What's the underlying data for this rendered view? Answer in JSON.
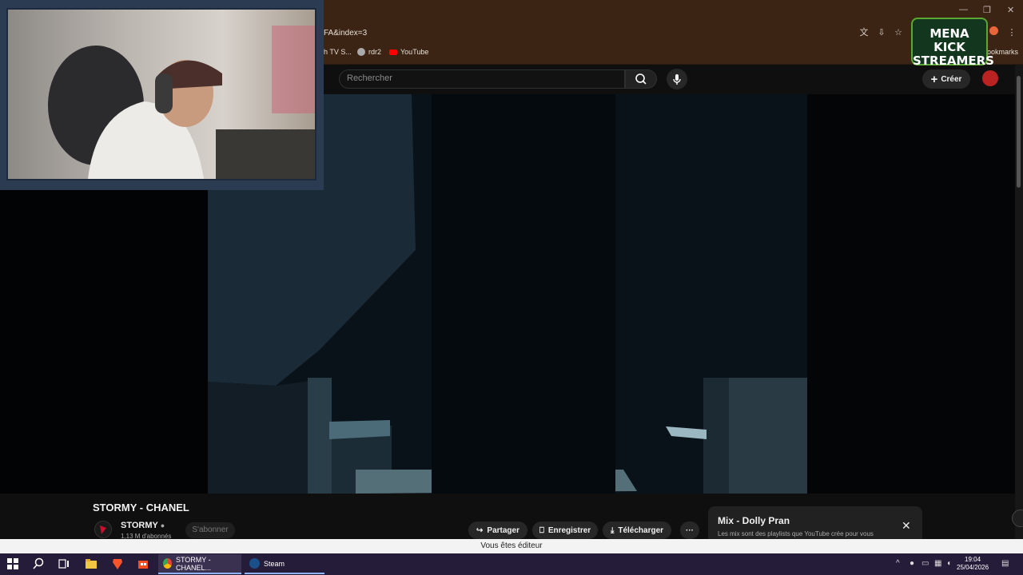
{
  "browser": {
    "url_fragment": "FA&index=3",
    "bookmarks": [
      {
        "label": "h TV S..."
      },
      {
        "label": "rdr2"
      },
      {
        "label": "YouTube"
      }
    ],
    "bookmarks_overflow": "ookmarks"
  },
  "youtube": {
    "search_placeholder": "Rechercher",
    "create_label": "Créer"
  },
  "overlay": {
    "logo_line1": "MENA KICK",
    "logo_line2": "STREAMERS"
  },
  "video": {
    "title": "STORMY - CHANEL",
    "channel": "STORMY",
    "subscribers": "1,13 M d'abonnés",
    "subscribe_label": "S'abonner",
    "actions": {
      "share": "Partager",
      "save": "Enregistrer",
      "download": "Télécharger",
      "more": "···"
    }
  },
  "mix": {
    "title": "Mix - Dolly Pran",
    "subtitle": "Les mix sont des playlists que YouTube crée pour vous"
  },
  "editor_notice": "Vous êtes éditeur",
  "taskbar": {
    "apps": [
      {
        "label": "STORMY - CHANEL..."
      },
      {
        "label": "Steam"
      }
    ],
    "time": "19:04",
    "date": "25/04/2026"
  },
  "colors": {
    "chrome_bg": "#3b2414",
    "yt_bg": "#0f0f0f",
    "taskbar_bg": "#251c3a",
    "logo_green": "#5aa832"
  }
}
